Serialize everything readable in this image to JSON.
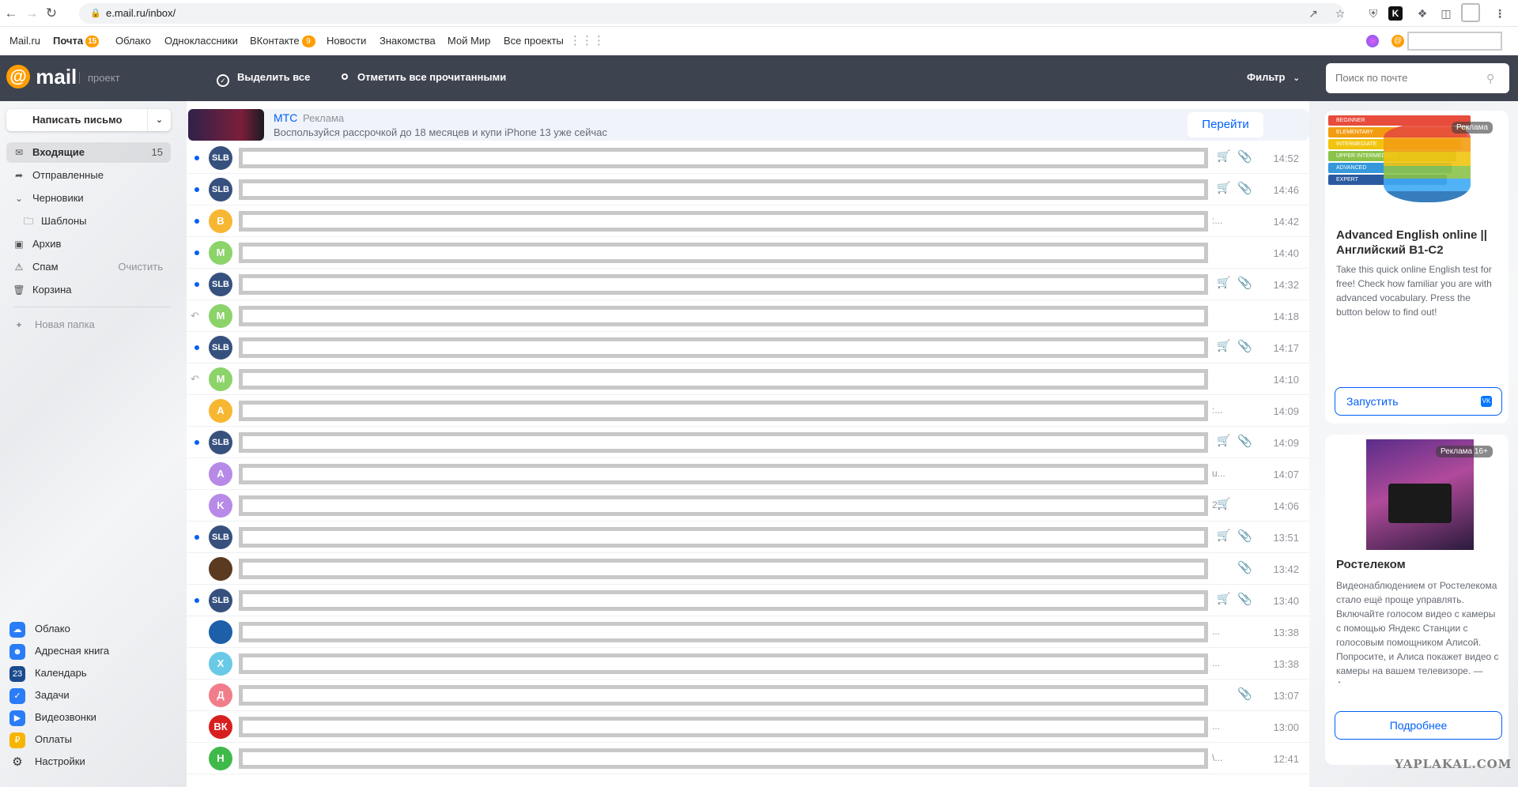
{
  "browser": {
    "url": "e.mail.ru/inbox/"
  },
  "portal": {
    "items": [
      {
        "label": "Mail.ru"
      },
      {
        "label": "Почта",
        "badge": "15"
      },
      {
        "label": "Облако"
      },
      {
        "label": "Одноклассники"
      },
      {
        "label": "ВКонтакте",
        "badge": "9"
      },
      {
        "label": "Новости"
      },
      {
        "label": "Знакомства"
      },
      {
        "label": "Мой Мир"
      },
      {
        "label": "Все проекты"
      }
    ]
  },
  "toolbar": {
    "logo": "mail",
    "project": "проект",
    "select_all": "Выделить все",
    "mark_read": "Отметить все прочитанными",
    "filter": "Фильтр",
    "search_placeholder": "Поиск по почте"
  },
  "sidebar": {
    "compose": "Написать письмо",
    "folders": [
      {
        "label": "Входящие",
        "count": "15",
        "icon": "inbox-icon"
      },
      {
        "label": "Отправленные",
        "icon": "sent-icon"
      },
      {
        "label": "Черновики",
        "icon": "chevron-down-icon"
      },
      {
        "label": "Шаблоны",
        "icon": "folder-icon"
      },
      {
        "label": "Архив",
        "icon": "archive-icon"
      },
      {
        "label": "Спам",
        "action": "Очистить",
        "icon": "spam-icon"
      },
      {
        "label": "Корзина",
        "icon": "trash-icon"
      }
    ],
    "new_folder": "Новая папка",
    "services": [
      {
        "label": "Облако",
        "color": "#2a7cf7",
        "icon": "cloud-icon"
      },
      {
        "label": "Адресная книга",
        "color": "#2a7cf7",
        "icon": "contacts-icon"
      },
      {
        "label": "Календарь",
        "color": "#1b4b8f",
        "icon": "calendar-icon",
        "glyph": "23"
      },
      {
        "label": "Задачи",
        "color": "#2a7cf7",
        "icon": "tasks-icon"
      },
      {
        "label": "Видеозвонки",
        "color": "#2a7cf7",
        "icon": "video-icon"
      },
      {
        "label": "Оплаты",
        "color": "#f7b500",
        "icon": "payments-icon"
      },
      {
        "label": "Настройки",
        "color": "#ffffff",
        "icon": "settings-icon"
      }
    ]
  },
  "ad_banner": {
    "sender": "МТС",
    "tag": "Реклама",
    "text": "Воспользуйся рассрочкой до 18 месяцев и купи iPhone 13 уже сейчас",
    "button": "Перейти"
  },
  "messages": [
    {
      "avatar": "SLB",
      "color": "#37517e",
      "unread": true,
      "cart": true,
      "clip": true,
      "time": "14:52"
    },
    {
      "avatar": "SLB",
      "color": "#37517e",
      "unread": true,
      "cart": true,
      "clip": true,
      "time": "14:46"
    },
    {
      "avatar": "B",
      "color": "#f7b733",
      "unread": true,
      "tail": ":...",
      "time": "14:42"
    },
    {
      "avatar": "M",
      "color": "#8cd36a",
      "unread": true,
      "time": "14:40"
    },
    {
      "avatar": "SLB",
      "color": "#37517e",
      "unread": true,
      "cart": true,
      "clip": true,
      "time": "14:32"
    },
    {
      "avatar": "M",
      "color": "#8cd36a",
      "replied": true,
      "time": "14:18"
    },
    {
      "avatar": "SLB",
      "color": "#37517e",
      "unread": true,
      "cart": true,
      "clip": true,
      "time": "14:17"
    },
    {
      "avatar": "M",
      "color": "#8cd36a",
      "replied": true,
      "time": "14:10"
    },
    {
      "avatar": "A",
      "color": "#f7b733",
      "tail": ":...",
      "time": "14:09"
    },
    {
      "avatar": "SLB",
      "color": "#37517e",
      "unread": true,
      "cart": true,
      "clip": true,
      "time": "14:09"
    },
    {
      "avatar": "A",
      "color": "#b78ae8",
      "tail": "u...",
      "time": "14:07"
    },
    {
      "avatar": "K",
      "color": "#b78ae8",
      "tail": "2...",
      "cart": true,
      "time": "14:06"
    },
    {
      "avatar": "SLB",
      "color": "#37517e",
      "unread": true,
      "cart": true,
      "clip": true,
      "time": "13:51"
    },
    {
      "avatar": "",
      "color": "#5a3a20",
      "clip": true,
      "time": "13:42"
    },
    {
      "avatar": "SLB",
      "color": "#37517e",
      "unread": true,
      "cart": true,
      "clip": true,
      "time": "13:40"
    },
    {
      "avatar": "",
      "color": "#1d5fa8",
      "tail": "...",
      "time": "13:38"
    },
    {
      "avatar": "X",
      "color": "#69c9e6",
      "tail": "...",
      "time": "13:38"
    },
    {
      "avatar": "Д",
      "color": "#f27d8a",
      "clip": true,
      "time": "13:07"
    },
    {
      "avatar": "ВК",
      "color": "#d81f1f",
      "tail": "...",
      "time": "13:00"
    },
    {
      "avatar": "Н",
      "color": "#3fb94a",
      "tail": "\\...",
      "time": "12:41"
    }
  ],
  "right_ads": [
    {
      "badge": "Реклама",
      "title": "Advanced English online || Английский B1-C2",
      "text": "Take this quick online English test for free! Check how familiar you are with advanced vocabulary. Press the button below to find out!",
      "button": "Запустить",
      "levels": [
        "BEGINNER",
        "ELEMENTARY",
        "INTERMEDIATE",
        "UPPER INTERMEDIATE",
        "ADVANCED",
        "EXPERT"
      ]
    },
    {
      "badge": "Реклама 16+",
      "title": "Ростелеком",
      "text": "Видеонаблюдением от Ростелекома стало ещё проще управлять. Включайте голосом видео с камеры с помощью Яндекс Станции с голосовым помощником Алисой. Попросите, и Алиса покажет видео с камеры на вашем телевизоре. — Алиса,",
      "button": "Подробнее"
    }
  ],
  "watermark": "YAPLAKAL.COM"
}
